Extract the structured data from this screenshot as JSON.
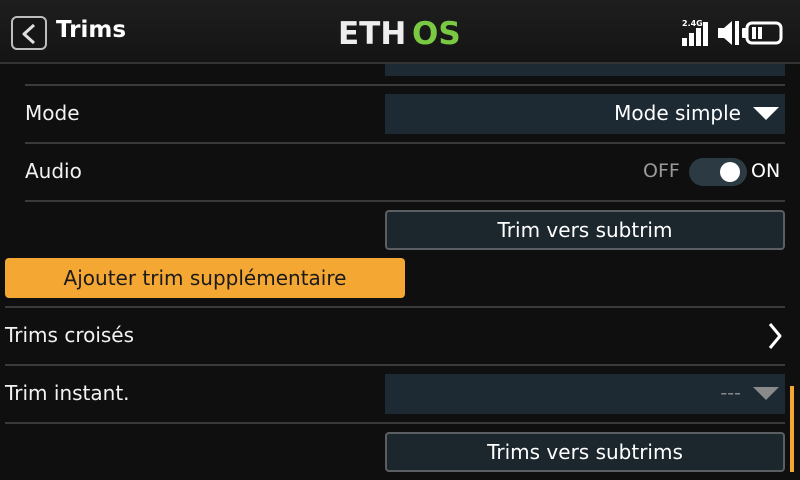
{
  "header": {
    "title": "Trims",
    "logo_left": "ETH",
    "logo_right": "OS",
    "logo_color_white": "#eeeeee",
    "logo_color_green": "#7ac943",
    "rf_band": "2.4G",
    "icons": [
      "back-arrow-icon",
      "signal-bars-icon",
      "speaker-icon",
      "battery-icon"
    ]
  },
  "settings": {
    "mode_label": "Mode",
    "mode_value": "Mode simple",
    "audio_label": "Audio",
    "audio_off": "OFF",
    "audio_on": "ON",
    "audio_state": "on",
    "trim_to_subtrim": "Trim vers subtrim",
    "add_extra_trim": "Ajouter trim supplémentaire",
    "cross_trims": "Trims croisés",
    "instant_trim_label": "Trim instant.",
    "instant_trim_value": "---",
    "trims_to_subtrims": "Trims vers subtrims"
  },
  "colors": {
    "accent": "#f5a733",
    "field_bg": "#1d2a33",
    "background": "#0f0f0f"
  }
}
